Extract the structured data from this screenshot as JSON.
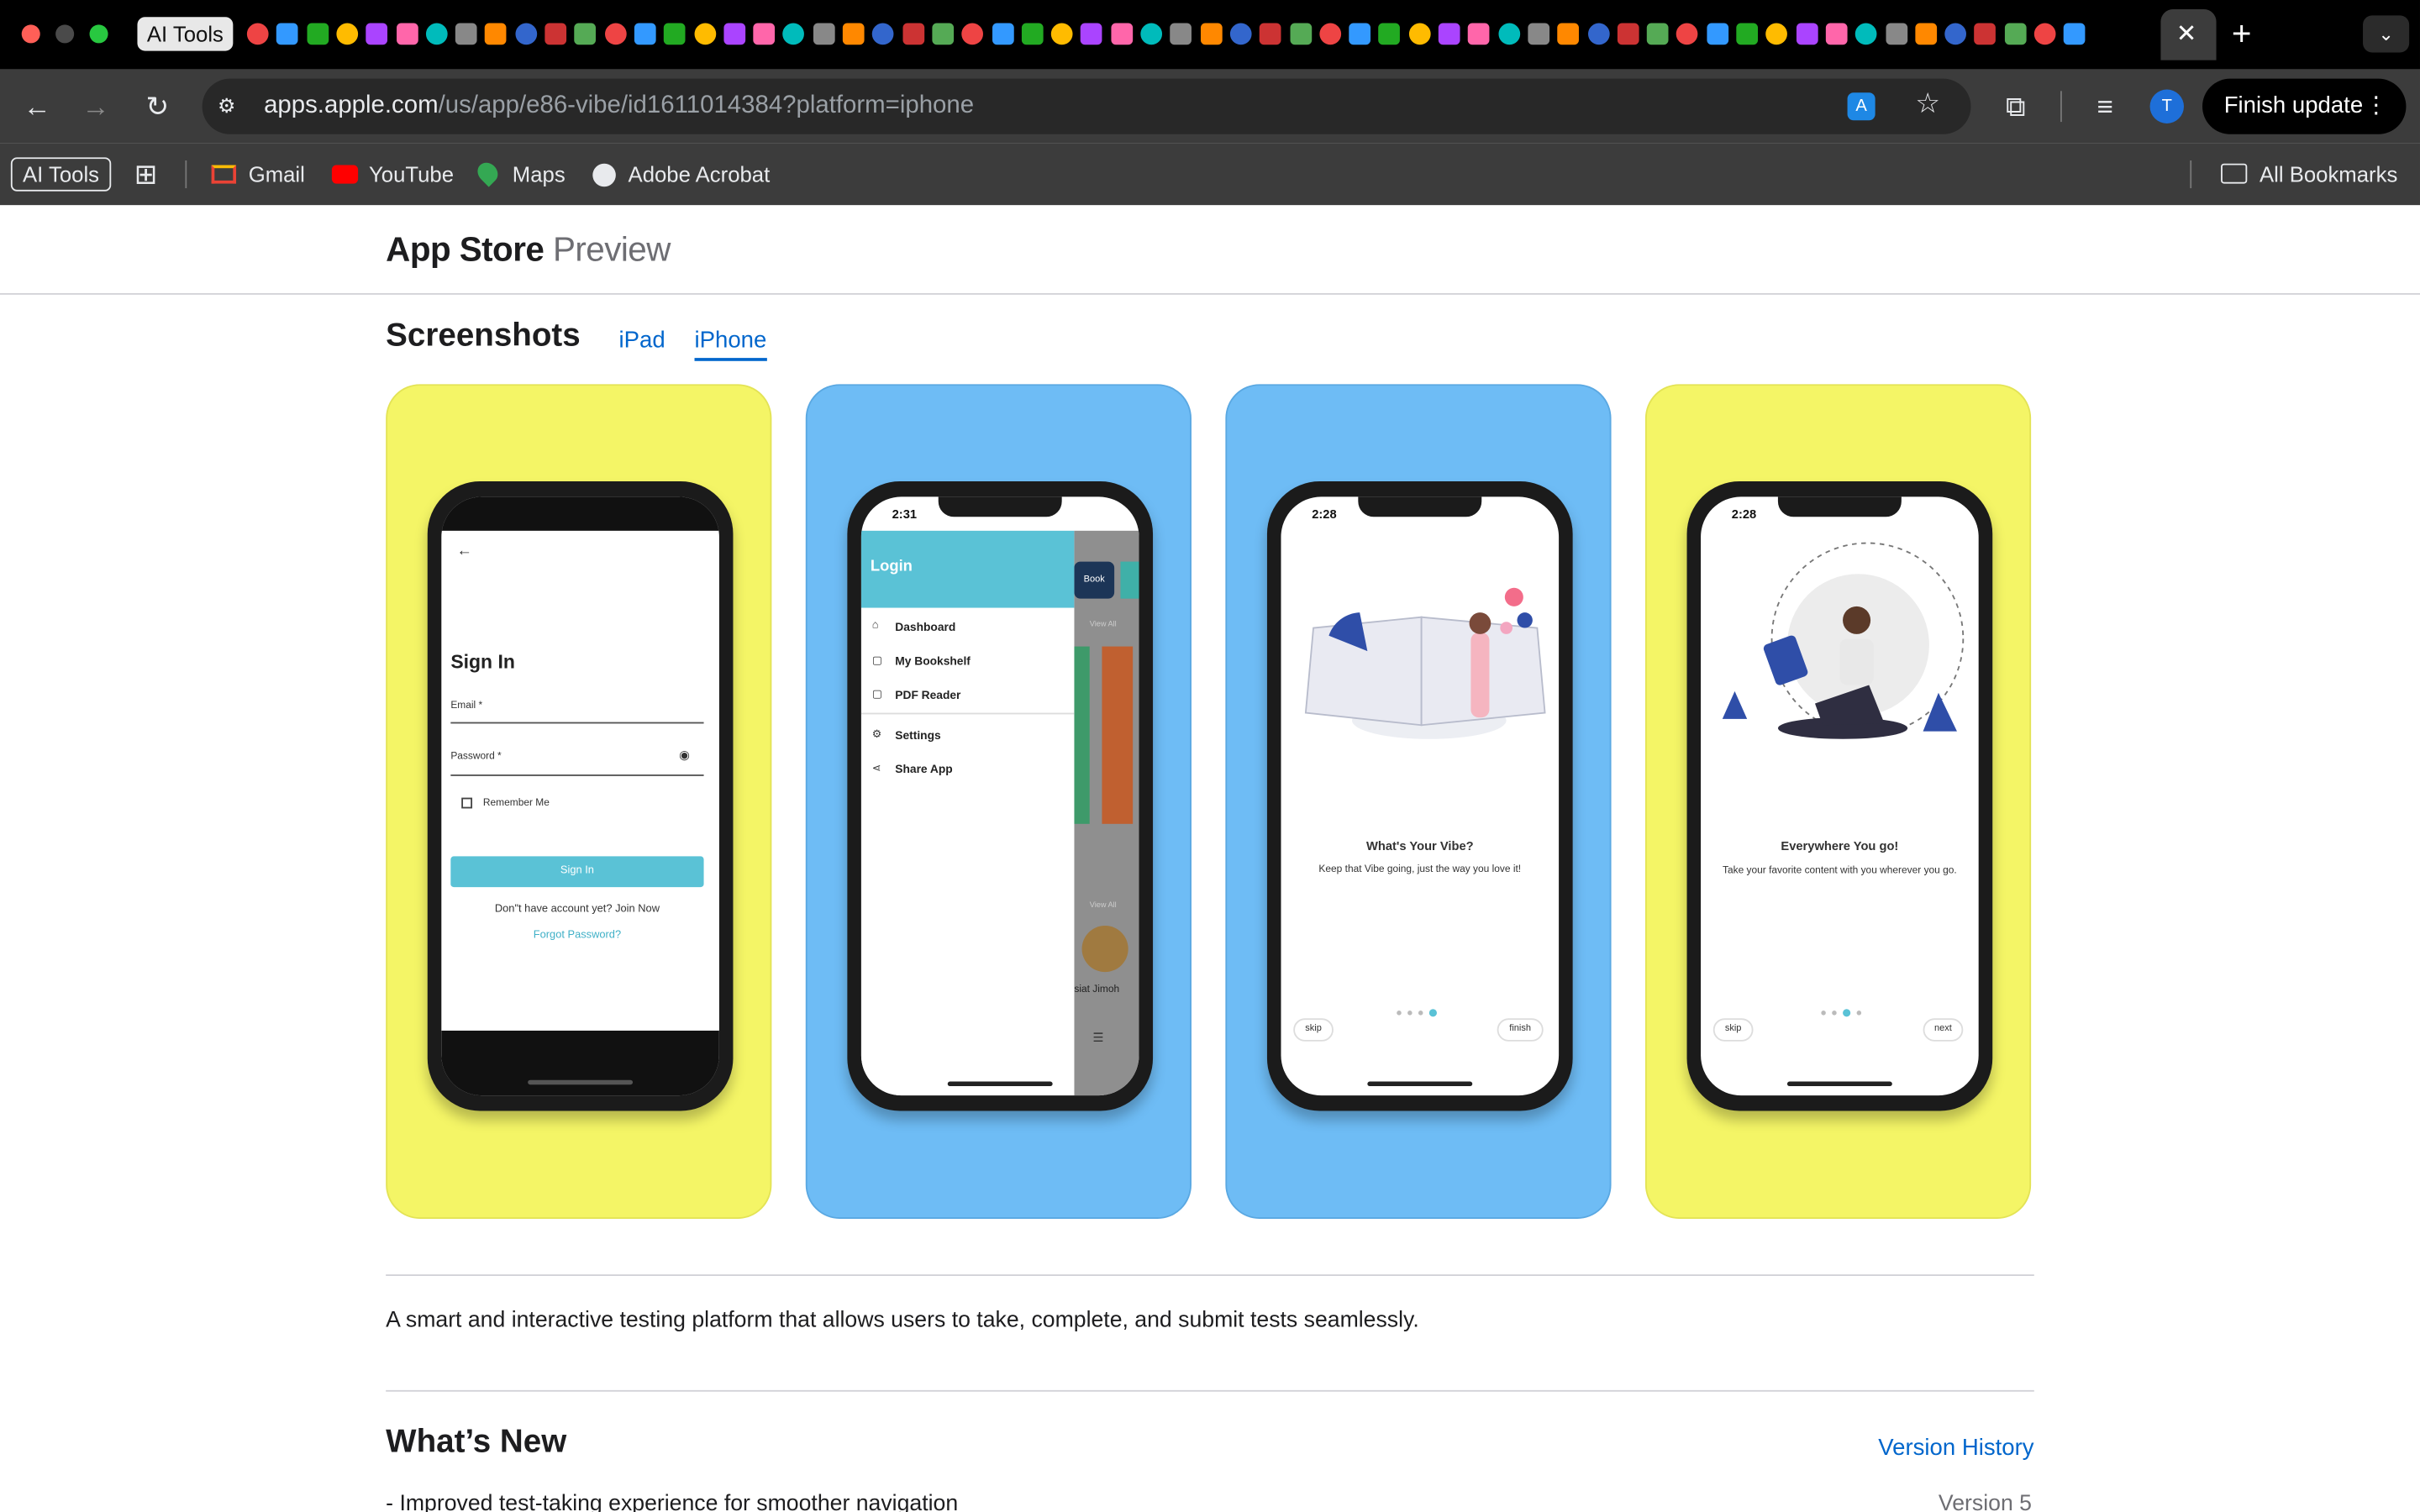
{
  "browser": {
    "tab_label": "AI Tools",
    "url_host": "apps.apple.com",
    "url_path": "/us/app/e86-vibe/id1611014384?platform=iphone",
    "finish_update": "Finish update",
    "profile_initial": "T",
    "bookmarks": [
      "AI Tools",
      "Gmail",
      "YouTube",
      "Maps",
      "Adobe Acrobat"
    ],
    "all_bookmarks": "All Bookmarks"
  },
  "page": {
    "brand": "App Store",
    "brand_sub": "Preview",
    "screenshots_title": "Screenshots",
    "tabs": [
      "iPad",
      "iPhone"
    ],
    "description": "A smart and interactive testing platform that allows users to take, complete, and submit tests seamlessly.",
    "whats_new_title": "What’s New",
    "version_history": "Version History",
    "release_note": "- Improved test-taking experience for smoother navigation",
    "version": "Version 5"
  },
  "screens": {
    "signin": {
      "title": "Sign In",
      "email": "Email *",
      "password": "Password *",
      "remember": "Remember Me",
      "button": "Sign In",
      "join": "Don\"t have  account yet? Join Now",
      "forgot": "Forgot Password?"
    },
    "drawer": {
      "time": "2:31",
      "header": "Login",
      "items": [
        "Dashboard",
        "My Bookshelf",
        "PDF Reader",
        "Settings",
        "Share App"
      ],
      "behind_book": "Book",
      "view_all": "View All",
      "behind_name": "siat Jimoh"
    },
    "onboard1": {
      "time": "2:28",
      "title": "What's Your Vibe?",
      "subtitle": "Keep that Vibe going, just the way you love it!",
      "skip": "skip",
      "finish": "finish"
    },
    "onboard2": {
      "time": "2:28",
      "title": "Everywhere You go!",
      "subtitle": "Take your favorite content with you wherever you go.",
      "skip": "skip",
      "next": "next"
    }
  },
  "colors": {
    "card_yellow": "#f4f566",
    "card_blue": "#6ebcf5",
    "accent_teal": "#5ac2d6",
    "link_blue": "#0066cc"
  }
}
